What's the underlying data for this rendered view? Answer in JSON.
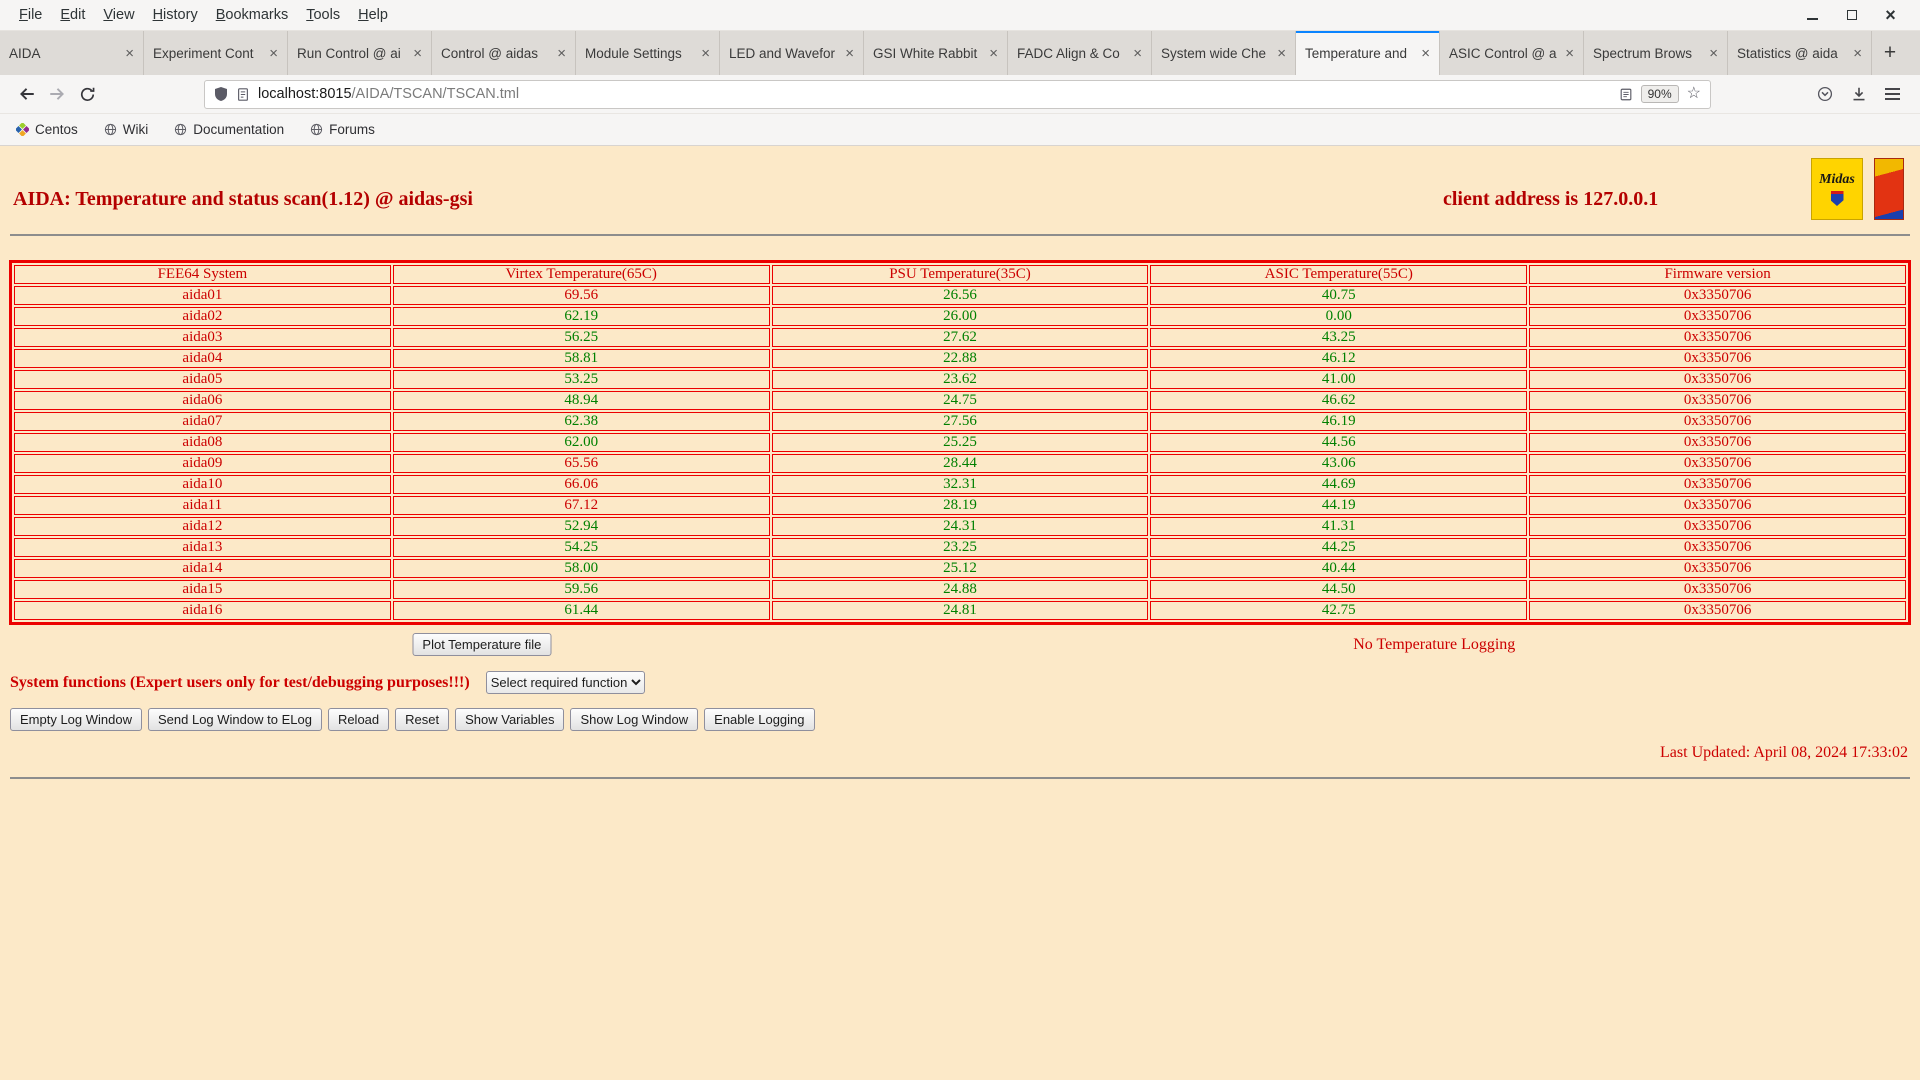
{
  "colors": {
    "accent_red": "#cc0000",
    "value_green": "#008000",
    "page_background": "#fce9c8",
    "table_border": "#ec0000",
    "active_tab_accent": "#0a84ff"
  },
  "browser": {
    "menu": [
      "File",
      "Edit",
      "View",
      "History",
      "Bookmarks",
      "Tools",
      "Help"
    ],
    "tabs": [
      {
        "label": "AIDA",
        "active": false
      },
      {
        "label": "Experiment Cont",
        "active": false
      },
      {
        "label": "Run Control @ ai",
        "active": false
      },
      {
        "label": "Control @ aidas",
        "active": false
      },
      {
        "label": "Module Settings",
        "active": false
      },
      {
        "label": "LED and Wavefor",
        "active": false
      },
      {
        "label": "GSI White Rabbit",
        "active": false
      },
      {
        "label": "FADC Align & Co",
        "active": false
      },
      {
        "label": "System wide Che",
        "active": false
      },
      {
        "label": "Temperature and",
        "active": true
      },
      {
        "label": "ASIC Control @ a",
        "active": false
      },
      {
        "label": "Spectrum Brows",
        "active": false
      },
      {
        "label": "Statistics @ aida",
        "active": false
      }
    ],
    "new_tab_button": "+",
    "url_host": "localhost:8015",
    "url_path": "/AIDA/TSCAN/TSCAN.tml",
    "zoom_level": "90%",
    "bookmarks": [
      "Centos",
      "Wiki",
      "Documentation",
      "Forums"
    ]
  },
  "page": {
    "title": "AIDA: Temperature and status scan(1.12) @ aidas-gsi",
    "client_address": "client address is 127.0.0.1",
    "midas_logo_text": "Midas",
    "table": {
      "headers": [
        "FEE64 System",
        "Virtex Temperature(65C)",
        "PSU Temperature(35C)",
        "ASIC Temperature(55C)",
        "Firmware version"
      ],
      "rows": [
        {
          "name": "aida01",
          "virtex": "69.56",
          "virtex_c": "red",
          "psu": "26.56",
          "psu_c": "green",
          "asic": "40.75",
          "asic_c": "green",
          "fw": "0x3350706"
        },
        {
          "name": "aida02",
          "virtex": "62.19",
          "virtex_c": "green",
          "psu": "26.00",
          "psu_c": "green",
          "asic": "0.00",
          "asic_c": "green",
          "fw": "0x3350706"
        },
        {
          "name": "aida03",
          "virtex": "56.25",
          "virtex_c": "green",
          "psu": "27.62",
          "psu_c": "green",
          "asic": "43.25",
          "asic_c": "green",
          "fw": "0x3350706"
        },
        {
          "name": "aida04",
          "virtex": "58.81",
          "virtex_c": "green",
          "psu": "22.88",
          "psu_c": "green",
          "asic": "46.12",
          "asic_c": "green",
          "fw": "0x3350706"
        },
        {
          "name": "aida05",
          "virtex": "53.25",
          "virtex_c": "green",
          "psu": "23.62",
          "psu_c": "green",
          "asic": "41.00",
          "asic_c": "green",
          "fw": "0x3350706"
        },
        {
          "name": "aida06",
          "virtex": "48.94",
          "virtex_c": "green",
          "psu": "24.75",
          "psu_c": "green",
          "asic": "46.62",
          "asic_c": "green",
          "fw": "0x3350706"
        },
        {
          "name": "aida07",
          "virtex": "62.38",
          "virtex_c": "green",
          "psu": "27.56",
          "psu_c": "green",
          "asic": "46.19",
          "asic_c": "green",
          "fw": "0x3350706"
        },
        {
          "name": "aida08",
          "virtex": "62.00",
          "virtex_c": "green",
          "psu": "25.25",
          "psu_c": "green",
          "asic": "44.56",
          "asic_c": "green",
          "fw": "0x3350706"
        },
        {
          "name": "aida09",
          "virtex": "65.56",
          "virtex_c": "red",
          "psu": "28.44",
          "psu_c": "green",
          "asic": "43.06",
          "asic_c": "green",
          "fw": "0x3350706"
        },
        {
          "name": "aida10",
          "virtex": "66.06",
          "virtex_c": "red",
          "psu": "32.31",
          "psu_c": "green",
          "asic": "44.69",
          "asic_c": "green",
          "fw": "0x3350706"
        },
        {
          "name": "aida11",
          "virtex": "67.12",
          "virtex_c": "red",
          "psu": "28.19",
          "psu_c": "green",
          "asic": "44.19",
          "asic_c": "green",
          "fw": "0x3350706"
        },
        {
          "name": "aida12",
          "virtex": "52.94",
          "virtex_c": "green",
          "psu": "24.31",
          "psu_c": "green",
          "asic": "41.31",
          "asic_c": "green",
          "fw": "0x3350706"
        },
        {
          "name": "aida13",
          "virtex": "54.25",
          "virtex_c": "green",
          "psu": "23.25",
          "psu_c": "green",
          "asic": "44.25",
          "asic_c": "green",
          "fw": "0x3350706"
        },
        {
          "name": "aida14",
          "virtex": "58.00",
          "virtex_c": "green",
          "psu": "25.12",
          "psu_c": "green",
          "asic": "40.44",
          "asic_c": "green",
          "fw": "0x3350706"
        },
        {
          "name": "aida15",
          "virtex": "59.56",
          "virtex_c": "green",
          "psu": "24.88",
          "psu_c": "green",
          "asic": "44.50",
          "asic_c": "green",
          "fw": "0x3350706"
        },
        {
          "name": "aida16",
          "virtex": "61.44",
          "virtex_c": "green",
          "psu": "24.81",
          "psu_c": "green",
          "asic": "42.75",
          "asic_c": "green",
          "fw": "0x3350706"
        }
      ]
    },
    "plot_button": "Plot Temperature file",
    "logging_status": "No Temperature Logging",
    "system_functions_label": "System functions (Expert users only for test/debugging purposes!!!)",
    "function_select_value": "Select required function",
    "action_buttons": [
      "Empty Log Window",
      "Send Log Window to ELog",
      "Reload",
      "Reset",
      "Show Variables",
      "Show Log Window",
      "Enable Logging"
    ],
    "last_updated": "Last Updated: April 08, 2024 17:33:02"
  }
}
